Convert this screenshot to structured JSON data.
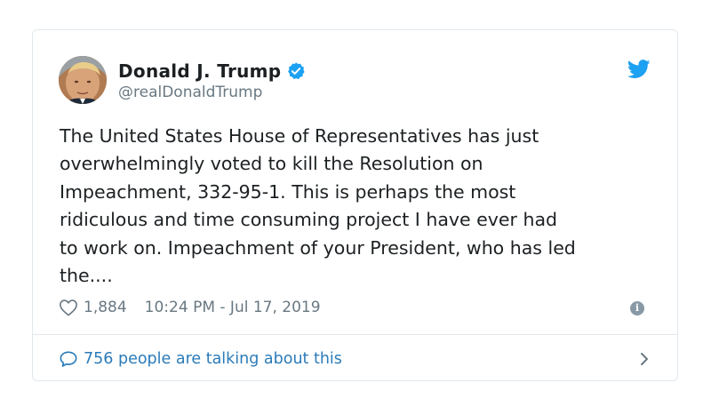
{
  "tweet": {
    "author": {
      "display_name": "Donald J. Trump",
      "handle": "@realDonaldTrump",
      "verified": true
    },
    "text": "The United States House of Representatives has just\noverwhelmingly voted to kill the Resolution on\nImpeachment, 332-95-1. This is perhaps the most\nridiculous and time consuming project I have ever had\nto work on. Impeachment of your President, who has led\nthe....",
    "like_count": "1,884",
    "timestamp": "10:24 PM - Jul 17, 2019",
    "footer_link": "756 people are talking about this"
  },
  "icons": {
    "brand": "twitter-bird-icon",
    "verified": "verified-badge-icon",
    "like": "heart-icon",
    "info": "info-icon",
    "reply": "speech-bubble-icon",
    "more": "chevron-right-icon"
  },
  "colors": {
    "twitter_blue": "#1da1f2",
    "link_blue": "#2b7bb9",
    "muted_text": "#697882",
    "text": "#1c2022",
    "border": "#e1e8ed"
  }
}
